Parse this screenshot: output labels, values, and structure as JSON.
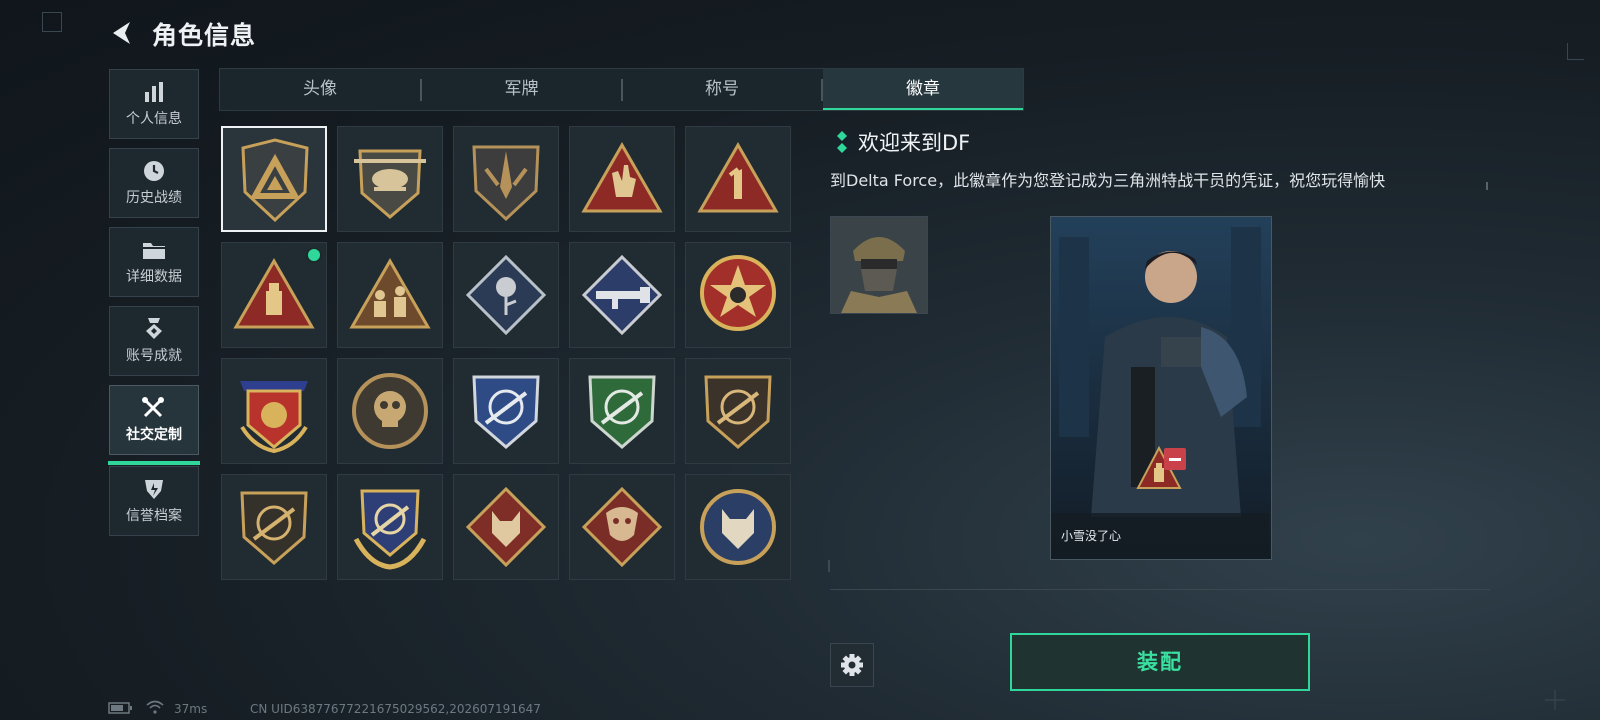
{
  "header": {
    "title": "角色信息",
    "back_icon": "back-arrow-icon"
  },
  "sidebar": {
    "items": [
      {
        "label": "个人信息",
        "icon": "bar-chart-icon",
        "active": false
      },
      {
        "label": "历史战绩",
        "icon": "clock-icon",
        "active": false
      },
      {
        "label": "详细数据",
        "icon": "folder-icon",
        "active": false
      },
      {
        "label": "账号成就",
        "icon": "medal-icon",
        "active": false
      },
      {
        "label": "社交定制",
        "icon": "tools-icon",
        "active": true
      },
      {
        "label": "信誉档案",
        "icon": "shield-icon",
        "active": false
      }
    ]
  },
  "tabs": [
    {
      "label": "头像",
      "active": false
    },
    {
      "label": "军牌",
      "active": false
    },
    {
      "label": "称号",
      "active": false
    },
    {
      "label": "徽章",
      "active": true
    }
  ],
  "badges": [
    [
      "delta-shield-badge-icon",
      "helicopter-badge-icon",
      "dagger-shield-badge-icon",
      "hand-sign-badge-icon",
      "number-one-badge-icon"
    ],
    [
      "usb-drive-badge-icon",
      "soldiers-badge-icon",
      "rose-diamond-badge-icon",
      "launcher-diamond-badge-icon",
      "star-emblem-badge-icon"
    ],
    [
      "winged-ribbon-badge-icon",
      "skull-round-badge-icon",
      "crosshair-rifle-blue-badge-icon",
      "crosshair-rifle-green-badge-icon",
      "crosshair-rifle-bronze-badge-icon"
    ],
    [
      "crosshair-rifle-gold-badge-icon",
      "crosshair-rifle-laurel-badge-icon",
      "wolf-diamond-badge-icon",
      "dragon-diamond-badge-icon",
      "lynx-round-badge-icon"
    ]
  ],
  "detail": {
    "badge_name": "欢迎来到DF",
    "badge_description": "到Delta Force，此徽章作为您登记成为三角洲特战干员的凭证，祝您玩得愉快",
    "player_name": "小雪没了心"
  },
  "actions": {
    "equip_label": "装配",
    "settings_icon": "gear-icon"
  },
  "status_bar": {
    "ping": "37ms",
    "uid": "CN UID63877677221675029562,202607191647"
  },
  "colors": {
    "accent": "#2fd89a",
    "background": "#1b242b",
    "panel": "#212b32",
    "badge_gold": "#c7a15a",
    "badge_red": "#8e2a26"
  }
}
